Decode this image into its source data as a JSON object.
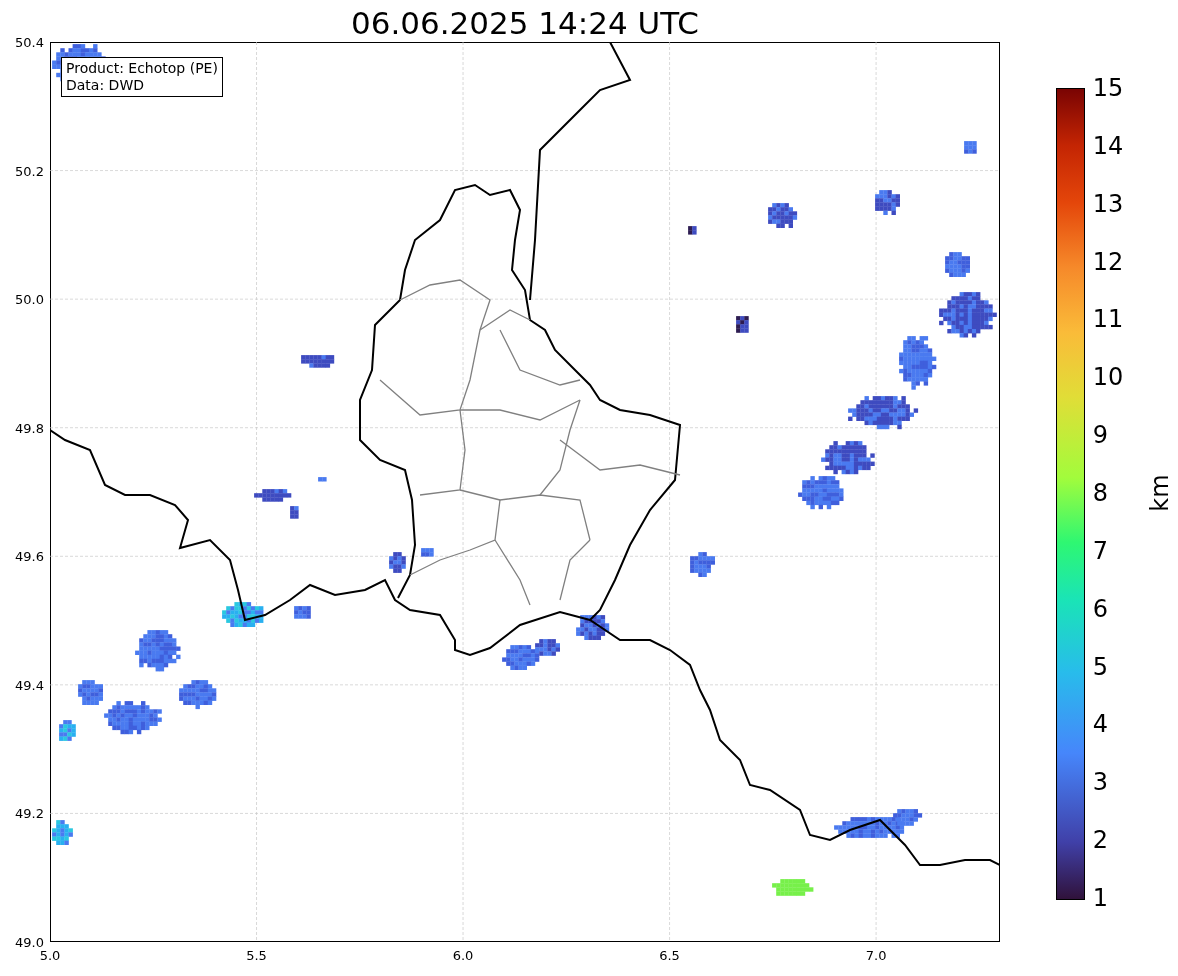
{
  "title": "06.06.2025 14:24 UTC",
  "legend": [
    "Product: Echotop (PE)",
    "Data: DWD"
  ],
  "x_ticks": [
    "5.0",
    "5.5",
    "6.0",
    "6.5",
    "7.0"
  ],
  "y_ticks": [
    "50.4",
    "50.2",
    "50.0",
    "49.8",
    "49.6",
    "49.4",
    "49.2",
    "49.0"
  ],
  "colorbar": {
    "label": "km",
    "ticks": [
      "15",
      "14",
      "13",
      "12",
      "11",
      "10",
      "9",
      "8",
      "7",
      "6",
      "5",
      "4",
      "3",
      "2",
      "1"
    ]
  }
}
